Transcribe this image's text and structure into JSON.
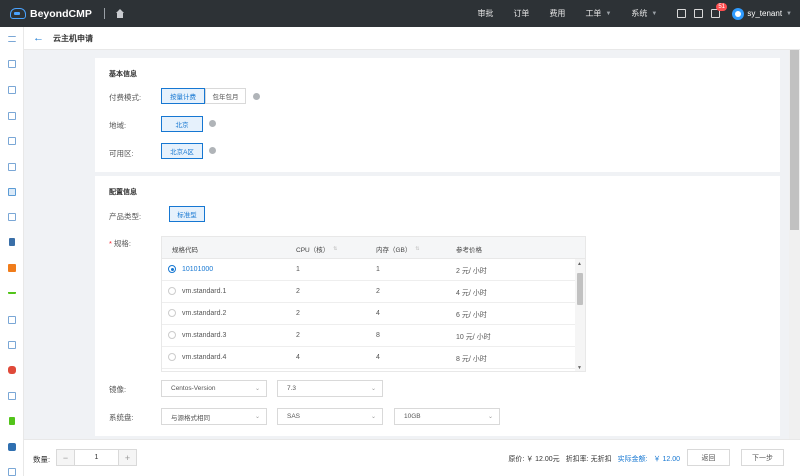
{
  "topbar": {
    "brand": "BeyondCMP",
    "nav": [
      "审批",
      "订单",
      "费用",
      "工单",
      "系统"
    ],
    "badge_count": "51",
    "user": "sy_tenant"
  },
  "page": {
    "title": "云主机申请"
  },
  "basic": {
    "section_title": "基本信息",
    "billing_label": "付费模式:",
    "billing_options": [
      "按量计费",
      "包年包月"
    ],
    "region_label": "地域:",
    "region_value": "北京",
    "zone_label": "可用区:",
    "zone_value": "北京A区"
  },
  "config": {
    "section_title": "配置信息",
    "product_type_label": "产品类型:",
    "product_type_value": "标准型",
    "spec_label": "规格:",
    "spec_columns": [
      "规格代码",
      "CPU（核）",
      "内存（GB）",
      "参考价格"
    ],
    "spec_rows": [
      {
        "code": "10101000",
        "cpu": "1",
        "mem": "1",
        "price": "2 元/ 小时",
        "selected": true
      },
      {
        "code": "vm.standard.1",
        "cpu": "2",
        "mem": "2",
        "price": "4 元/ 小时",
        "selected": false
      },
      {
        "code": "vm.standard.2",
        "cpu": "2",
        "mem": "4",
        "price": "6 元/ 小时",
        "selected": false
      },
      {
        "code": "vm.standard.3",
        "cpu": "2",
        "mem": "8",
        "price": "10 元/ 小时",
        "selected": false
      },
      {
        "code": "vm.standard.4",
        "cpu": "4",
        "mem": "4",
        "price": "8 元/ 小时",
        "selected": false
      }
    ],
    "image_label": "镜像:",
    "image_os": "Centos-Version",
    "image_version": "7.3",
    "disk_label": "系统盘:",
    "disk_format": "与源格式相同",
    "disk_type": "SAS",
    "disk_size": "10GB"
  },
  "footer": {
    "qty_label": "数量:",
    "qty_value": "1",
    "original_price": "原价: ￥ 12.00元",
    "discount": "折扣率: 无折扣",
    "total_label": "实际金额:",
    "total_value": "￥ 12.00",
    "back_button": "返回",
    "next_button": "下一步"
  },
  "colors": {
    "topbar": "#2d3236",
    "accent": "#1677d2"
  }
}
